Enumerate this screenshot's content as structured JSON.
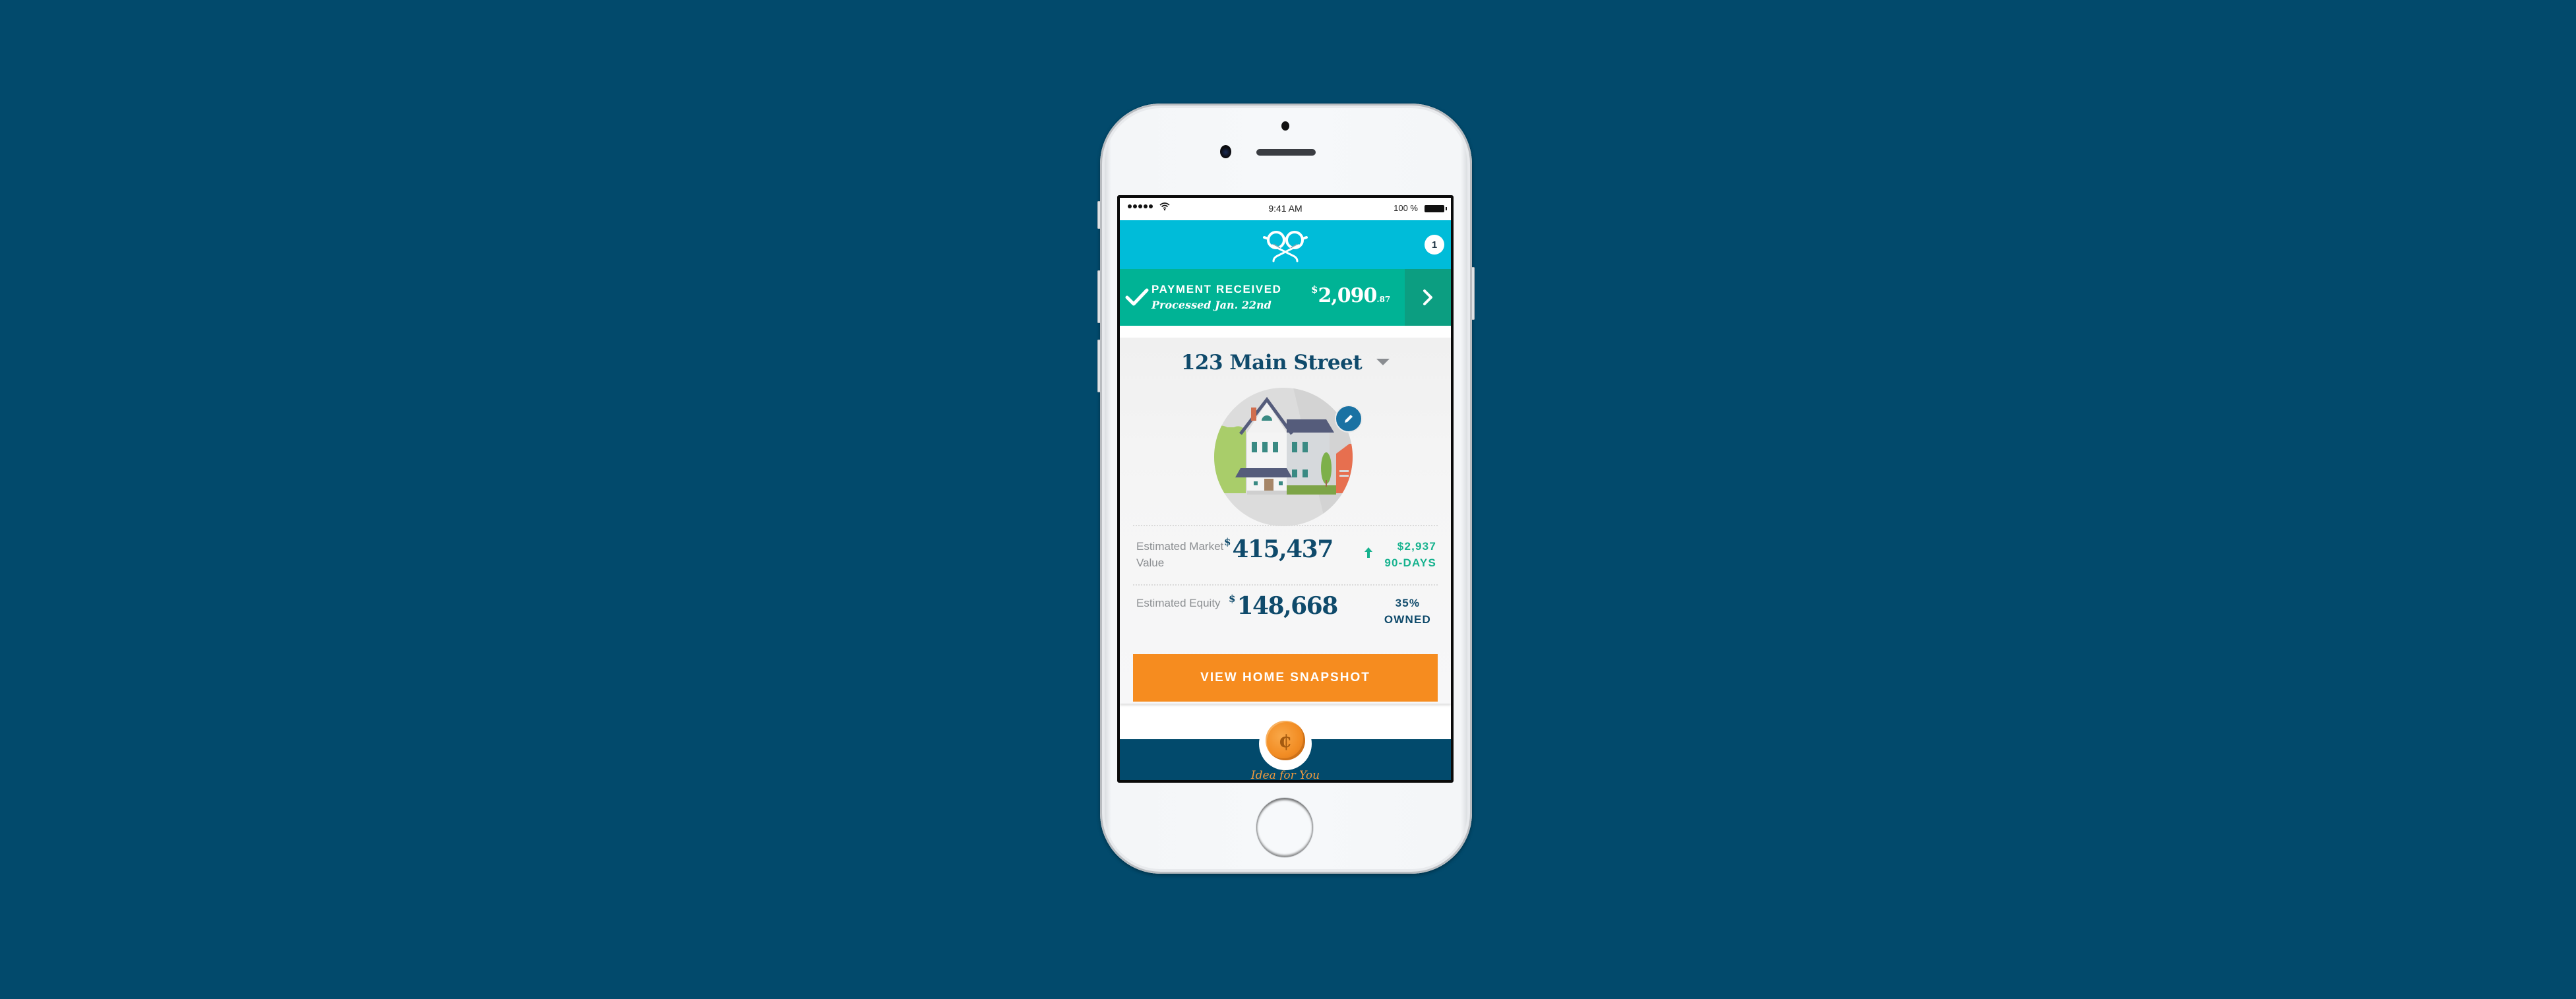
{
  "status_bar": {
    "time": "9:41 AM",
    "battery_percent": "100 %",
    "signal_bars": 5,
    "icons": [
      "signal-dots",
      "wifi-icon",
      "battery-icon"
    ]
  },
  "header": {
    "logo": "glasses-logo-icon",
    "notification_count": "1"
  },
  "payment": {
    "title": "PAYMENT RECEIVED",
    "subtitle": "Processed Jan. 22nd",
    "currency_symbol": "$",
    "amount_dollars": "2,090",
    "amount_cents": ".87",
    "icons": [
      "check-icon",
      "chevron-right-icon"
    ]
  },
  "property": {
    "address": "123 Main Street",
    "image": "house-illustration",
    "edit_icon": "pencil-icon",
    "market_value": {
      "label": "Estimated Market Value",
      "currency_symbol": "$",
      "value": "415,437",
      "change_amount": "$2,937",
      "change_period": "90-DAYS",
      "change_direction": "up"
    },
    "equity": {
      "label": "Estimated Equity",
      "currency_symbol": "$",
      "value": "148,668",
      "owned_percent": "35%",
      "owned_label": "OWNED"
    },
    "cta_label": "VIEW HOME SNAPSHOT"
  },
  "idea": {
    "icon": "coin-cent-icon",
    "coin_glyph": "¢",
    "label": "Idea for You"
  },
  "colors": {
    "background": "#024a6c",
    "header": "#00bcd9",
    "payment_banner": "#00b395",
    "payment_arrow": "#0c9e81",
    "primary_text": "#0f4a6b",
    "positive_change": "#16b28e",
    "cta": "#f68c1f",
    "edit_button": "#1a72a3"
  }
}
